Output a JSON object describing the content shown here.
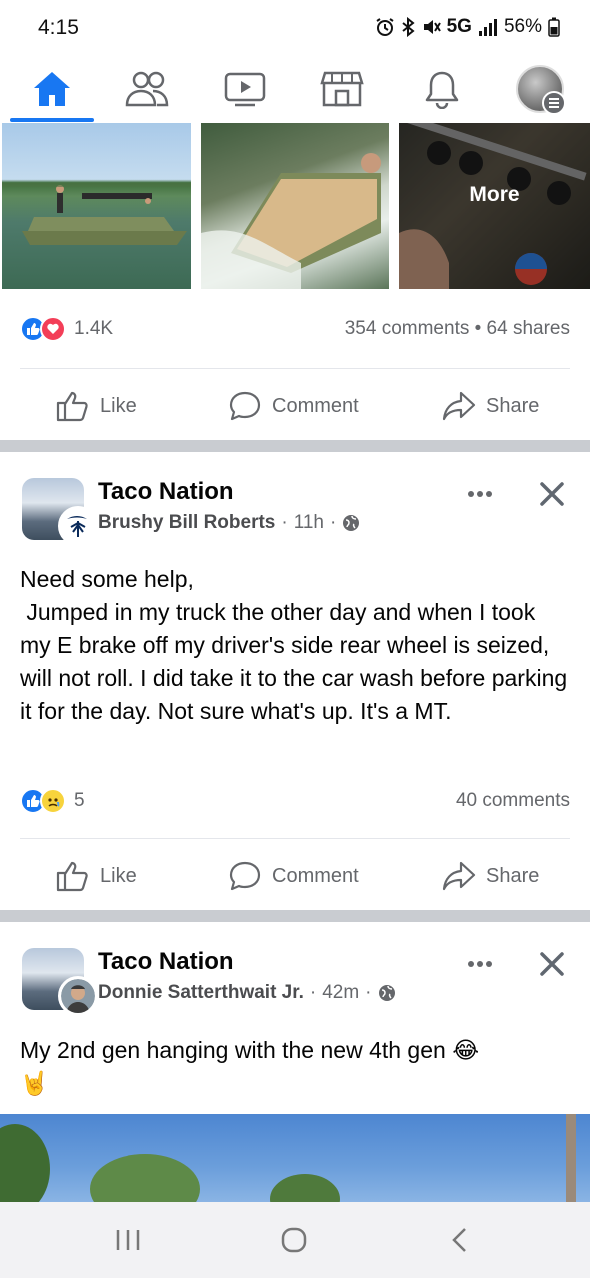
{
  "status_bar": {
    "time": "4:15",
    "network": "5G",
    "battery": "56%"
  },
  "top_nav": {
    "items": [
      "home",
      "friends",
      "watch",
      "marketplace",
      "notifications",
      "profile-menu"
    ],
    "active": "home",
    "accent_color": "#1877f2"
  },
  "post1": {
    "photo_more_label": "More",
    "reaction_count": "1.4K",
    "comments_shares": "354 comments • 64 shares",
    "actions": {
      "like": "Like",
      "comment": "Comment",
      "share": "Share"
    }
  },
  "post2": {
    "group": "Taco Nation",
    "author": "Brushy Bill Roberts",
    "time": "11h",
    "text": "Need some help,\n Jumped in my truck the other day and when I took my E brake off my driver's side rear wheel is seized, will not roll. I did take it to the car wash before parking it for the day. Not sure what's up. It's a MT.",
    "reaction_count": "5",
    "comments": "40 comments",
    "actions": {
      "like": "Like",
      "comment": "Comment",
      "share": "Share"
    }
  },
  "post3": {
    "group": "Taco Nation",
    "author": "Donnie Satterthwait Jr.",
    "time": "42m",
    "text": "My 2nd gen hanging with the new 4th gen 😂\n🤘"
  }
}
